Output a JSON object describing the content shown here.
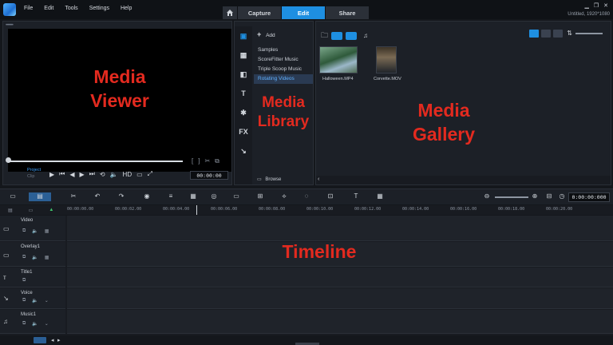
{
  "menu": [
    "File",
    "Edit",
    "Tools",
    "Settings",
    "Help"
  ],
  "tabs": [
    {
      "label": "Capture",
      "active": false
    },
    {
      "label": "Edit",
      "active": true
    },
    {
      "label": "Share",
      "active": false
    }
  ],
  "project_name": "Untitled, 1920*1080",
  "viewer": {
    "label_line1": "Media",
    "label_line2": "Viewer",
    "project_mode": "Project",
    "clip_mode": "Clip",
    "hd": "HD",
    "timecode": "00:00:00"
  },
  "library": {
    "add_label": "Add",
    "items": [
      {
        "label": "Samples",
        "selected": false
      },
      {
        "label": "ScoreFitter Music",
        "selected": false
      },
      {
        "label": "Triple Scoop Music",
        "selected": false
      },
      {
        "label": "Rotating Videos",
        "selected": true
      }
    ],
    "label_line1": "Media",
    "label_line2": "Library",
    "browse_label": "Browse"
  },
  "gallery": {
    "thumbs": [
      {
        "caption": "Halloween.MP4"
      },
      {
        "caption": "Corvette.MOV"
      }
    ],
    "label_line1": "Media",
    "label_line2": "Gallery"
  },
  "timeline": {
    "label": "Timeline",
    "timecode": "0:00:00:000",
    "ruler": [
      "00:00:00.00",
      "00:00:02.00",
      "00:00:04.00",
      "00:00:06.00",
      "00:00:08.00",
      "00:00:10.00",
      "00:00:12.00",
      "00:00:14.00",
      "00:00:16.00",
      "00:00:18.00",
      "00:00:20.00"
    ],
    "tracks": [
      "Video",
      "Overlay1",
      "Title1",
      "Voice",
      "Music1"
    ]
  },
  "colors": {
    "accent": "#1e8fe1",
    "label_red": "#e32a1f"
  }
}
